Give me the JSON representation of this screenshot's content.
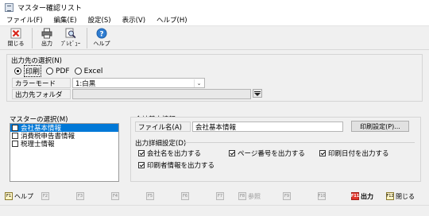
{
  "window": {
    "title": "マスター確認リスト"
  },
  "menu": [
    "ファイル(F)",
    "編集(E)",
    "設定(S)",
    "表示(V)",
    "ヘルプ(H)"
  ],
  "toolbar": {
    "close": "閉じる",
    "output": "出力",
    "preview": "ﾌﾟﾚﾋﾞｭｰ",
    "help": "ヘルプ"
  },
  "output_dest": {
    "label": "出力先の選択(N)",
    "options": [
      "印刷",
      "PDF",
      "Excel"
    ],
    "selected": "印刷",
    "color_mode_label": "カラーモード",
    "color_mode_value": "1:白黒",
    "folder_label": "出力先フォルダ",
    "folder_value": ""
  },
  "master_select": {
    "label": "マスターの選択(M)",
    "items": [
      {
        "label": "会社基本情報",
        "checked": false,
        "selected": true
      },
      {
        "label": "消費税申告書情報",
        "checked": false,
        "selected": false
      },
      {
        "label": "税理士情報",
        "checked": false,
        "selected": false
      }
    ]
  },
  "company_info": {
    "label": "会社基本情報",
    "filename_label": "ファイル名(A)",
    "filename_value": "会社基本情報",
    "print_settings_button": "印刷設定(P)...",
    "detail_label": "出力詳細設定(D)",
    "options": [
      {
        "label": "会社名を出力する",
        "checked": true
      },
      {
        "label": "ページ番号を出力する",
        "checked": true
      },
      {
        "label": "印刷日付を出力する",
        "checked": true
      },
      {
        "label": "印刷者情報を出力する",
        "checked": true
      }
    ]
  },
  "fkeys": [
    {
      "key": "F1",
      "label": "ヘルプ",
      "active": true
    },
    {
      "key": "F2",
      "label": "",
      "active": false
    },
    {
      "key": "F3",
      "label": "",
      "active": false
    },
    {
      "key": "F4",
      "label": "",
      "active": false
    },
    {
      "key": "F5",
      "label": "",
      "active": false
    },
    {
      "key": "F6",
      "label": "",
      "active": false
    },
    {
      "key": "F7",
      "label": "",
      "active": false
    },
    {
      "key": "F8",
      "label": "参照",
      "active": false
    },
    {
      "key": "F9",
      "label": "",
      "active": false
    },
    {
      "key": "F10",
      "label": "",
      "active": false
    },
    {
      "key": "F11",
      "label": "出力",
      "active": true,
      "red": true
    },
    {
      "key": "F12",
      "label": "閉じる",
      "active": true
    }
  ]
}
